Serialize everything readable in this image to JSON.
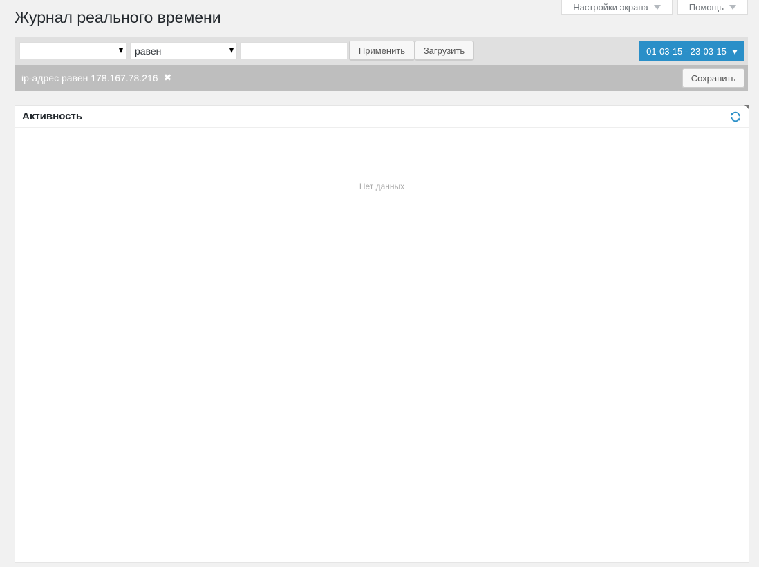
{
  "screen_meta": {
    "screen_options_label": "Настройки экрана",
    "help_label": "Помощь"
  },
  "page": {
    "title": "Журнал реального времени"
  },
  "toolbar": {
    "field_select_value": "",
    "operator_select_value": "равен",
    "value_input": "",
    "apply_label": "Применить",
    "load_label": "Загрузить",
    "date_range_label": "01-03-15 - 23-03-15",
    "accent_color": "#2a8fc8"
  },
  "filter_bar": {
    "active_filter_text": "ip-адрес равен 178.167.78.216",
    "remove_icon": "close-icon",
    "save_label": "Сохранить"
  },
  "panel": {
    "title": "Активность",
    "refresh_icon": "refresh-icon",
    "empty_text": "Нет данных"
  }
}
